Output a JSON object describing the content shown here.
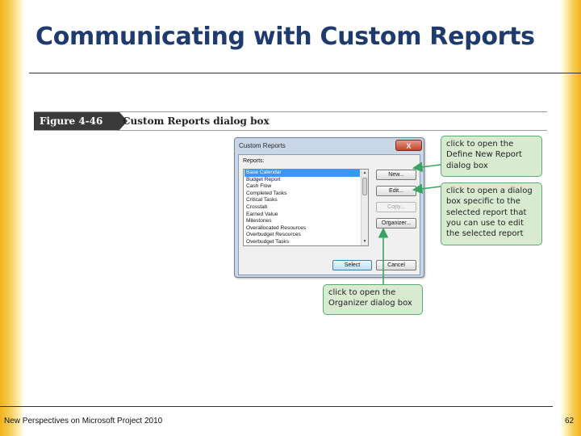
{
  "slide": {
    "title": "Communicating with Custom Reports",
    "footer": "New Perspectives on Microsoft Project 2010",
    "page_number": "62"
  },
  "figure": {
    "label": "Figure 4-46",
    "caption": "Custom Reports dialog box"
  },
  "dialog": {
    "title": "Custom Reports",
    "close_glyph": "X",
    "reports_label": "Reports:",
    "reports": [
      "Base Calendar",
      "Budget Report",
      "Cash Flow",
      "Completed Tasks",
      "Critical Tasks",
      "Crosstab",
      "Earned Value",
      "Milestones",
      "Overallocated Resources",
      "Overbudget Resources",
      "Overbudget Tasks"
    ],
    "selected_report": "Base Calendar",
    "buttons": {
      "new": "New...",
      "edit": "Edit...",
      "copy": "Copy...",
      "organizer": "Organizer...",
      "select": "Select",
      "cancel": "Cancel"
    }
  },
  "callouts": {
    "new": [
      "click to open the",
      "Define New Report",
      "dialog box"
    ],
    "edit": [
      "click to open a dialog",
      "box specific to the",
      "selected report that",
      "you can use to edit",
      "the selected report"
    ],
    "organizer": [
      "click to open the",
      "Organizer dialog box"
    ]
  },
  "colors": {
    "title": "#1f3a6d",
    "callout_fill": "#d8ead0",
    "callout_border": "#5aaa73",
    "selection": "#3399ff",
    "edge_gold": "#f2b21a"
  }
}
